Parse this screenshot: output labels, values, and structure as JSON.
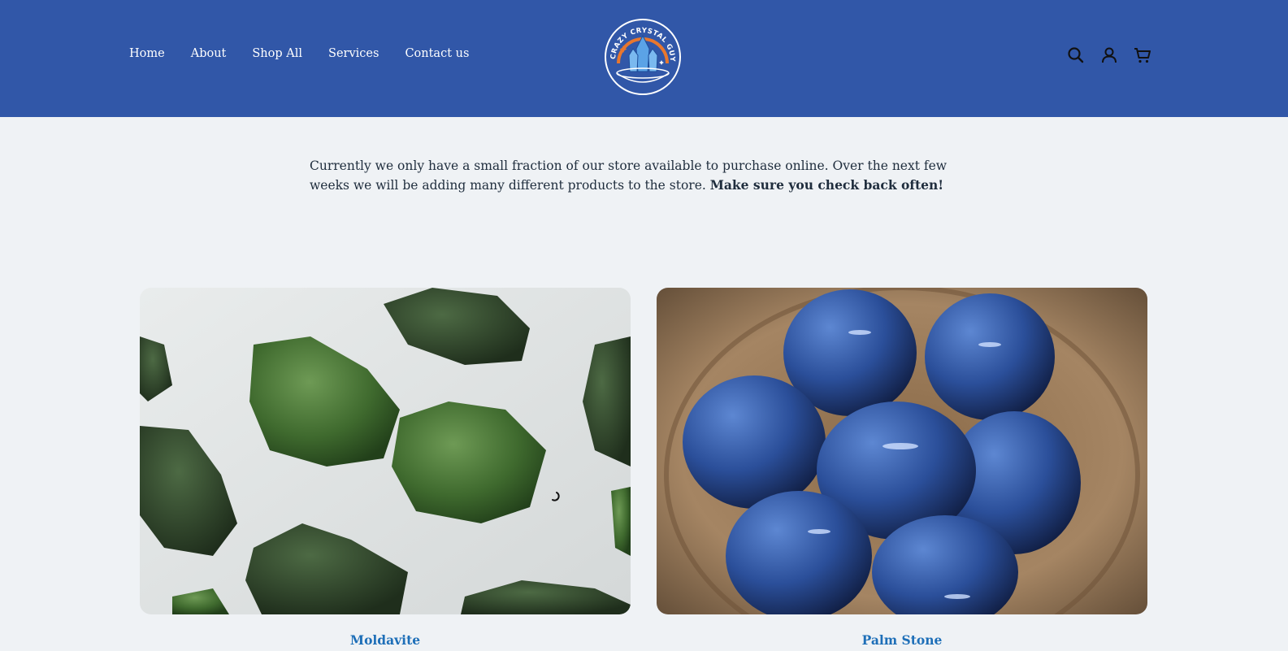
{
  "nav": {
    "items": [
      {
        "label": "Home"
      },
      {
        "label": "About"
      },
      {
        "label": "Shop All"
      },
      {
        "label": "Services"
      },
      {
        "label": "Contact us"
      }
    ]
  },
  "logo": {
    "text": "2 CRAZY CRYSTAL GUYS"
  },
  "header_icons": [
    "search-icon",
    "account-icon",
    "cart-icon"
  ],
  "notice": {
    "text": "Currently we only have a small fraction of our store available to purchase online. Over the next few weeks we will be adding many different products to the store.",
    "bold": "Make sure you check back often!"
  },
  "products": [
    {
      "title": "Moldavite"
    },
    {
      "title": "Palm Stone"
    }
  ],
  "colors": {
    "header_bg": "#3157a8",
    "page_bg": "#eff2f5",
    "link": "#1e6fb8",
    "logo_orange": "#e8772e"
  }
}
